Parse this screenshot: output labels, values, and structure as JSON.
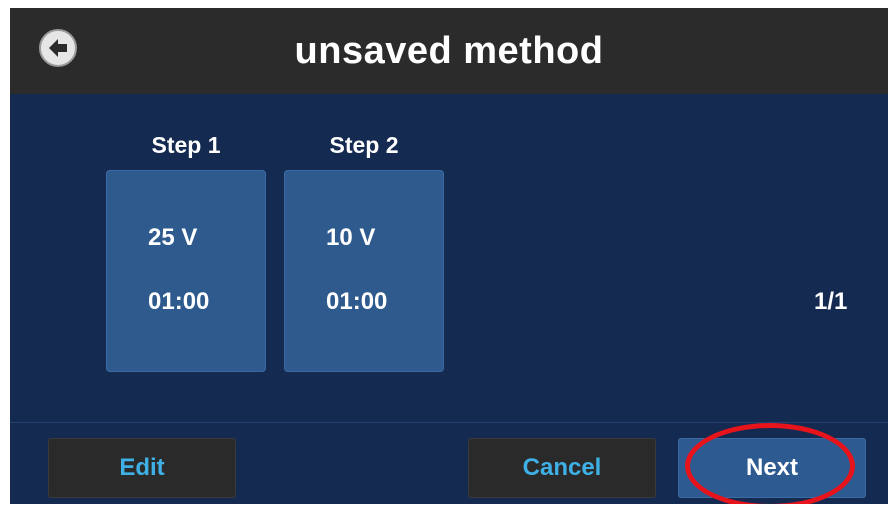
{
  "header": {
    "title": "unsaved method",
    "back_icon": "arrow-left-circle-icon"
  },
  "steps": [
    {
      "label": "Step 1",
      "voltage": "25 V",
      "time": "01:00"
    },
    {
      "label": "Step 2",
      "voltage": "10 V",
      "time": "01:00"
    }
  ],
  "pagination": "1/1",
  "buttons": {
    "edit_label": "Edit",
    "cancel_label": "Cancel",
    "next_label": "Next"
  },
  "colors": {
    "background": "#152a50",
    "header": "#2b2b2b",
    "step_card": "#2e5a8e",
    "dark_button": "#2a2a2a",
    "dark_button_text": "#3fb0e6",
    "highlight": "#e8141c"
  }
}
